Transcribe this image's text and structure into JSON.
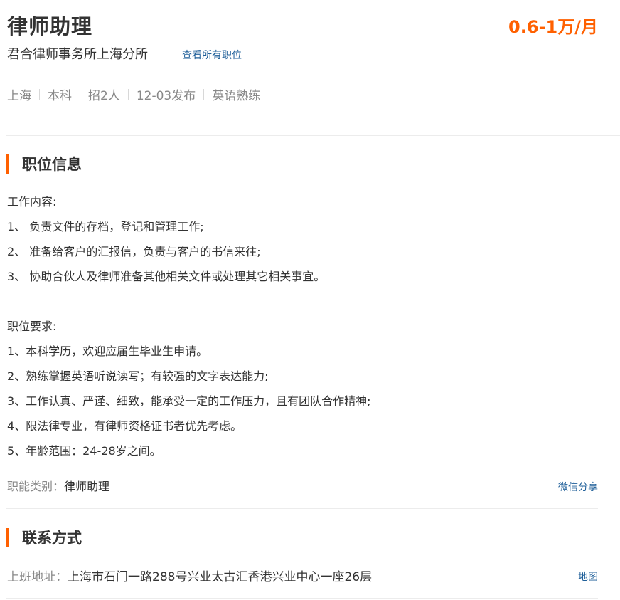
{
  "header": {
    "job_title": "律师助理",
    "salary": "0.6-1万/月",
    "company_name": "君合律师事务所上海分所",
    "view_all_label": "查看所有职位"
  },
  "meta": [
    "上海",
    "本科",
    "招2人",
    "12-03发布",
    "英语熟练"
  ],
  "job_info": {
    "section_title": "职位信息",
    "duties_heading": "工作内容:",
    "duties": [
      "1、 负责文件的存档，登记和管理工作;",
      "2、 准备给客户的汇报信，负责与客户的书信来往;",
      "3、 协助合伙人及律师准备其他相关文件或处理其它相关事宜。"
    ],
    "requirements_heading": "职位要求:",
    "requirements": [
      "1、本科学历，欢迎应届生毕业生申请。",
      "2、熟练掌握英语听说读写；有较强的文字表达能力;",
      "3、工作认真、严谨、细致，能承受一定的工作压力，且有团队合作精神;",
      "4、限法律专业，有律师资格证书者优先考虑。",
      "5、年龄范围：24-28岁之间。"
    ],
    "category_label": "职能类别：",
    "category_value": "律师助理",
    "share_label": "微信分享"
  },
  "contact": {
    "section_title": "联系方式",
    "address_label": "上班地址：",
    "address_value": "上海市石门一路288号兴业太古汇香港兴业中心一座26层",
    "map_label": "地图"
  },
  "colors": {
    "accent": "#ff6000",
    "link": "#1f5f99",
    "muted": "#888888"
  }
}
